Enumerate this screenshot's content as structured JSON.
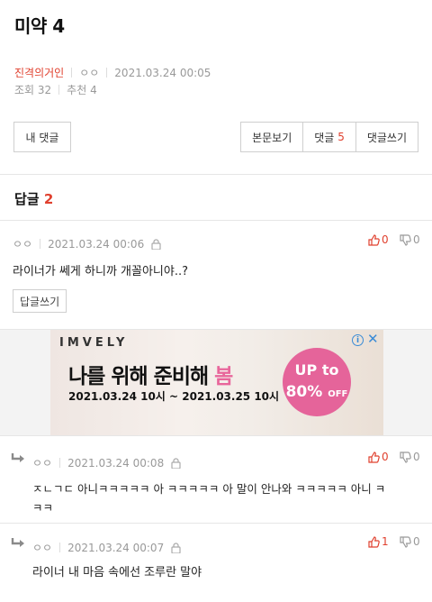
{
  "post": {
    "title": "미약 4",
    "author": "진격의거인",
    "nick": "ㅇㅇ",
    "datetime": "2021.03.24 00:05",
    "views": "조회 32",
    "likes": "추천 4"
  },
  "buttons": {
    "my_comments": "내 댓글",
    "view_body": "본문보기",
    "comments_label": "댓글",
    "comments_count": "5",
    "write_comment": "댓글쓰기"
  },
  "replies": {
    "label": "답글",
    "count": "2"
  },
  "comments": [
    {
      "nick": "ㅇㅇ",
      "datetime": "2021.03.24 00:06",
      "text": "라이너가 쎄게 하니까 개꼴아니야..?",
      "up": "0",
      "down": "0",
      "reply_btn": "답글쓰기"
    },
    {
      "nick": "ㅇㅇ",
      "datetime": "2021.03.24 00:08",
      "text_line1": "ㅈㄴㄱㄷ 아니ㅋㅋㅋㅋㅋ 아 ㅋㅋㅋㅋㅋ 아 말이 안나와 ㅋㅋㅋㅋㅋ 아니 ㅋ",
      "text_line2": "ㅋㅋ",
      "up": "0",
      "down": "0"
    },
    {
      "nick": "ㅇㅇ",
      "datetime": "2021.03.24 00:07",
      "text": "라이너 내 마음 속에선 조루란 말야",
      "up": "1",
      "down": "0"
    }
  ],
  "ad": {
    "brand": "IMVELY",
    "headline": "나를 위해 준비해",
    "headline_accent": "봄",
    "dates": "2021.03.24 10시 ~ 2021.03.25 10시",
    "badge_line1": "UP to",
    "badge_pct": "80%",
    "badge_off": "OFF"
  },
  "colors": {
    "accent": "#e0402e",
    "ad_pink": "#e5649a"
  }
}
